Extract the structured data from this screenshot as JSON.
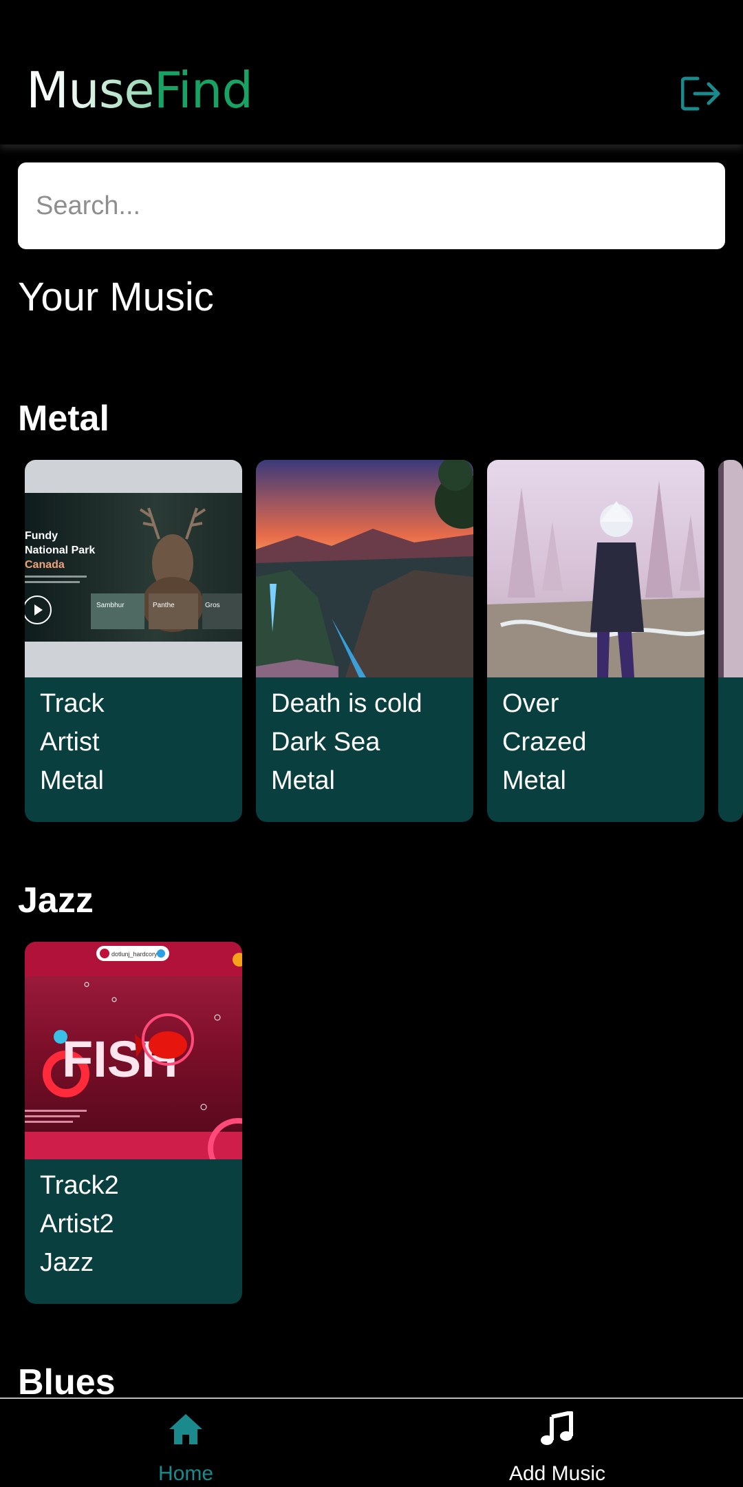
{
  "app": {
    "logo_part1": "Muse",
    "logo_part2": "Find",
    "accent_color": "#17a364",
    "card_color": "#093f3f"
  },
  "header": {
    "logout_icon": "logout-icon"
  },
  "search": {
    "placeholder": "Search...",
    "value": ""
  },
  "main": {
    "section_title": "Your Music",
    "genres": [
      {
        "name": "Metal",
        "cards": [
          {
            "track": "Track",
            "artist": "Artist",
            "genre": "Metal",
            "cover": "deer-website-cover"
          },
          {
            "track": "Death is cold",
            "artist": "Dark Sea",
            "genre": "Metal",
            "cover": "fantasy-landscape-cover"
          },
          {
            "track": "Over",
            "artist": "Crazed",
            "genre": "Metal",
            "cover": "white-haired-warrior-cover"
          }
        ]
      },
      {
        "name": "Jazz",
        "cards": [
          {
            "track": "Track2",
            "artist": "Artist2",
            "genre": "Jazz",
            "cover": "fish-website-cover"
          }
        ]
      },
      {
        "name": "Blues",
        "cards": []
      }
    ]
  },
  "cover_texts": {
    "deer": {
      "line1": "Fundy",
      "line2": "National Park",
      "line3": "Canada",
      "thumb1": "Sambhur",
      "thumb2": "Panthe",
      "thumb3": "Gros"
    },
    "fish": {
      "title": "FISH",
      "badge": "dotlunj_hardcory"
    }
  },
  "bottom_nav": {
    "items": [
      {
        "label": "Home",
        "icon": "home-icon",
        "active": true
      },
      {
        "label": "Add Music",
        "icon": "music-note-icon",
        "active": false
      }
    ],
    "active_color": "#1a8a8c"
  }
}
